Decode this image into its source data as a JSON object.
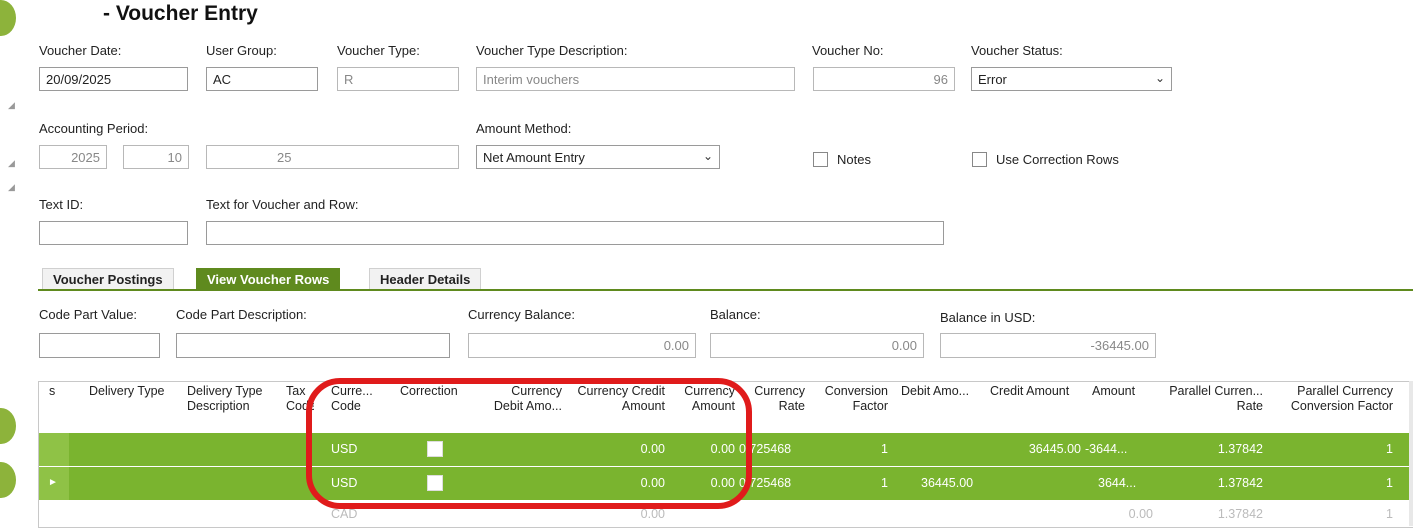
{
  "header": {
    "title": "- Voucher Entry"
  },
  "voucher": {
    "date_label": "Voucher Date:",
    "date_value": "20/09/2025",
    "user_group_label": "User Group:",
    "user_group_value": "AC",
    "type_label": "Voucher Type:",
    "type_value": "R",
    "type_desc_label": "Voucher Type Description:",
    "type_desc_value": "Interim vouchers",
    "no_label": "Voucher No:",
    "no_value": "96",
    "status_label": "Voucher Status:",
    "status_value": "Error",
    "acc_period_label": "Accounting Period:",
    "acc_year": "2025",
    "acc_period": "10",
    "acc_period_text": "25",
    "amount_method_label": "Amount Method:",
    "amount_method_value": "Net Amount Entry",
    "notes_label": "Notes",
    "correction_rows_label": "Use Correction Rows",
    "text_id_label": "Text ID:",
    "text_id_value": "",
    "text_voucher_label": "Text for Voucher and Row:",
    "text_voucher_value": ""
  },
  "tabs": [
    {
      "label": "Voucher Postings"
    },
    {
      "label": "View Voucher Rows"
    },
    {
      "label": "Header Details"
    }
  ],
  "summary": {
    "code_part_value_label": "Code Part Value:",
    "code_part_value": "",
    "code_part_desc_label": "Code Part Description:",
    "code_part_desc": "",
    "currency_balance_label": "Currency Balance:",
    "currency_balance": "0.00",
    "balance_label": "Balance:",
    "balance": "0.00",
    "balance_usd_label": "Balance in USD:",
    "balance_usd": "-36445.00"
  },
  "grid": {
    "columns": [
      "s",
      "Delivery Type",
      "Delivery Type Description",
      "Tax Code",
      "Curre... Code",
      "Correction",
      "Currency Debit Amo...",
      "Currency Credit Amount",
      "Currency Amount",
      "Currency Rate",
      "Conversion Factor",
      "Debit Amo...",
      "Credit Amount",
      "Amount",
      "Parallel Curren... Rate",
      "Parallel Currency Conversion Factor"
    ],
    "rows": [
      {
        "currency_code": "USD",
        "currency_debit": "",
        "currency_credit": "0.00",
        "currency_amount": "0.00",
        "currency_rate": "0.725468",
        "conversion_factor": "1",
        "debit_amount": "",
        "credit_amount": "36445.00",
        "amount": "-3644...",
        "parallel_rate": "1.37842",
        "parallel_factor": "1"
      },
      {
        "currency_code": "USD",
        "currency_debit": "",
        "currency_credit": "0.00",
        "currency_amount": "0.00",
        "currency_rate": "0.725468",
        "conversion_factor": "1",
        "debit_amount": "36445.00",
        "credit_amount": "",
        "amount": "3644...",
        "parallel_rate": "1.37842",
        "parallel_factor": "1"
      }
    ],
    "row3": {
      "currency_code": "CAD",
      "currency_credit": "0.00",
      "amount": "0.00",
      "parallel_rate": "1.37842",
      "parallel_factor": "1"
    },
    "row_marker": "►"
  }
}
